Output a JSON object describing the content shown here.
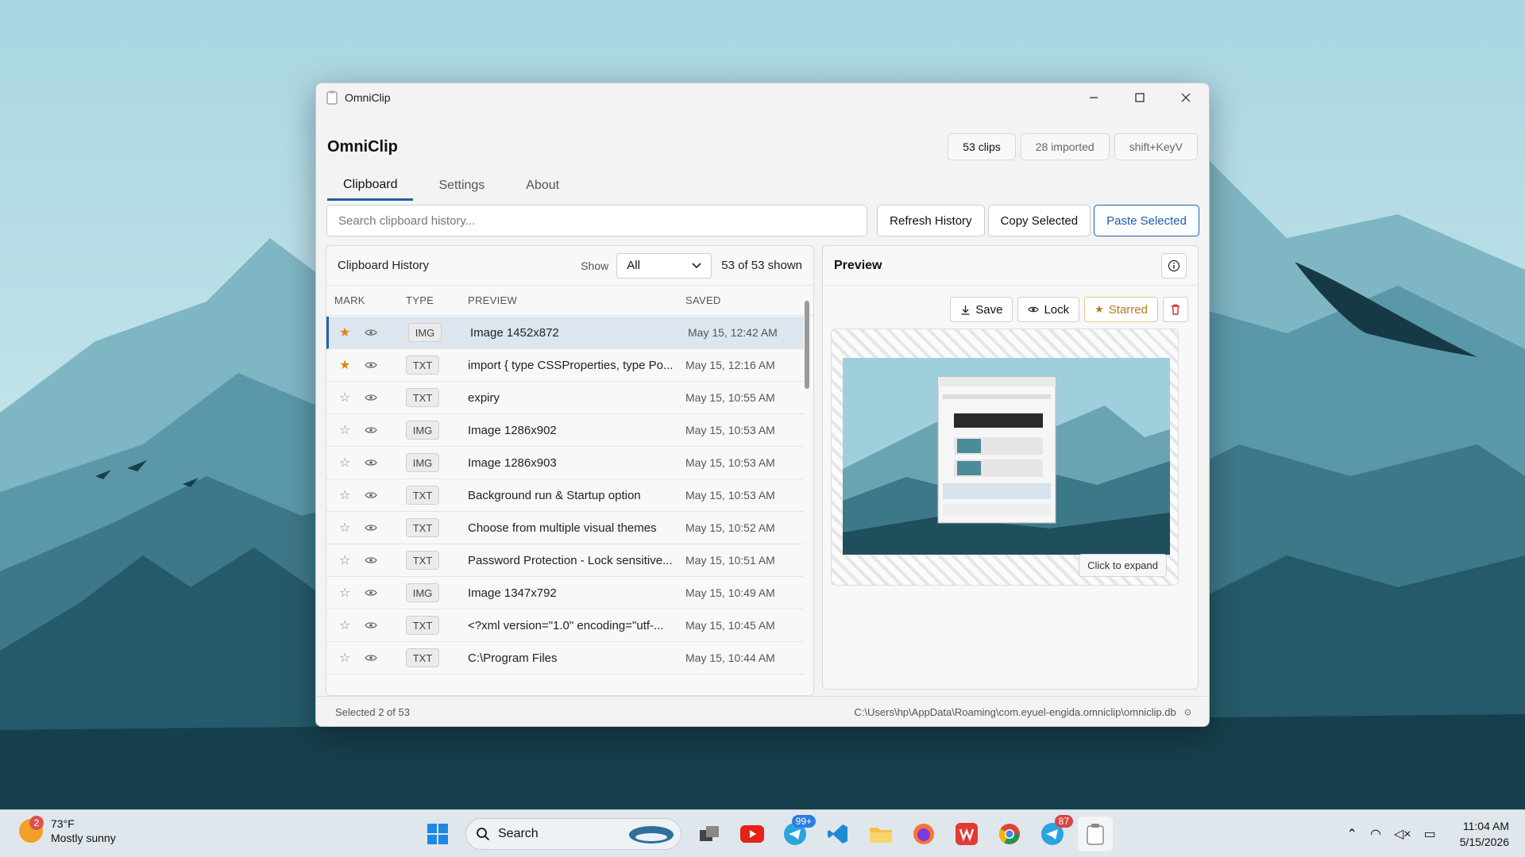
{
  "window": {
    "title": "OmniClip",
    "minimize": "–",
    "maximize": "□",
    "close": "✕"
  },
  "header": {
    "app_title": "OmniClip",
    "pills": [
      "53 clips",
      "28 imported",
      "shift+KeyV"
    ]
  },
  "tabs": [
    "Clipboard",
    "Settings",
    "About"
  ],
  "toolbar": {
    "search_placeholder": "Search clipboard history...",
    "refresh": "Refresh History",
    "copy": "Copy Selected",
    "paste": "Paste Selected"
  },
  "history": {
    "title": "Clipboard History",
    "show_label": "Show",
    "filter_value": "All",
    "count": "53 of 53 shown",
    "columns": [
      "MARK",
      "TYPE",
      "PREVIEW",
      "SAVED"
    ],
    "rows": [
      {
        "starred": true,
        "type": "IMG",
        "preview": "Image 1452x872",
        "saved": "May 15, 12:42 AM"
      },
      {
        "starred": true,
        "type": "TXT",
        "preview": "import { type CSSProperties, type Po...",
        "saved": "May 15, 12:16 AM"
      },
      {
        "starred": false,
        "type": "TXT",
        "preview": "expiry",
        "saved": "May 15, 10:55 AM"
      },
      {
        "starred": false,
        "type": "IMG",
        "preview": "Image 1286x902",
        "saved": "May 15, 10:53 AM"
      },
      {
        "starred": false,
        "type": "IMG",
        "preview": "Image 1286x903",
        "saved": "May 15, 10:53 AM"
      },
      {
        "starred": false,
        "type": "TXT",
        "preview": "Background run & Startup option",
        "saved": "May 15, 10:53 AM"
      },
      {
        "starred": false,
        "type": "TXT",
        "preview": "Choose from multiple visual themes",
        "saved": "May 15, 10:52 AM"
      },
      {
        "starred": false,
        "type": "TXT",
        "preview": "Password Protection - Lock sensitive...",
        "saved": "May 15, 10:51 AM"
      },
      {
        "starred": false,
        "type": "IMG",
        "preview": "Image 1347x792",
        "saved": "May 15, 10:49 AM"
      },
      {
        "starred": false,
        "type": "TXT",
        "preview": "<?xml version=\"1.0\" encoding=\"utf-...",
        "saved": "May 15, 10:45 AM"
      },
      {
        "starred": false,
        "type": "TXT",
        "preview": "C:\\Program Files",
        "saved": "May 15, 10:44 AM"
      }
    ],
    "scroll_fraction": 0.22
  },
  "preview": {
    "title": "Preview",
    "save": "Save",
    "lock": "Lock",
    "starred": "Starred",
    "expand": "Click to expand"
  },
  "status": {
    "selected": "Selected 2 of 53",
    "db_path": "C:\\Users\\hp\\AppData\\Roaming\\com.eyuel-engida.omniclip\\omniclip.db"
  },
  "taskbar": {
    "weather_temp": "73°F",
    "weather_desc": "Mostly sunny",
    "weather_badge": "2",
    "search": "Search",
    "telegram_badge": "99+",
    "telegram2_badge": "87",
    "time": "11:04 AM",
    "date": "5/15/2026"
  },
  "colors": {
    "accent": "#1f5fa8",
    "star": "#d98a0f",
    "delete": "#d12b2b"
  }
}
